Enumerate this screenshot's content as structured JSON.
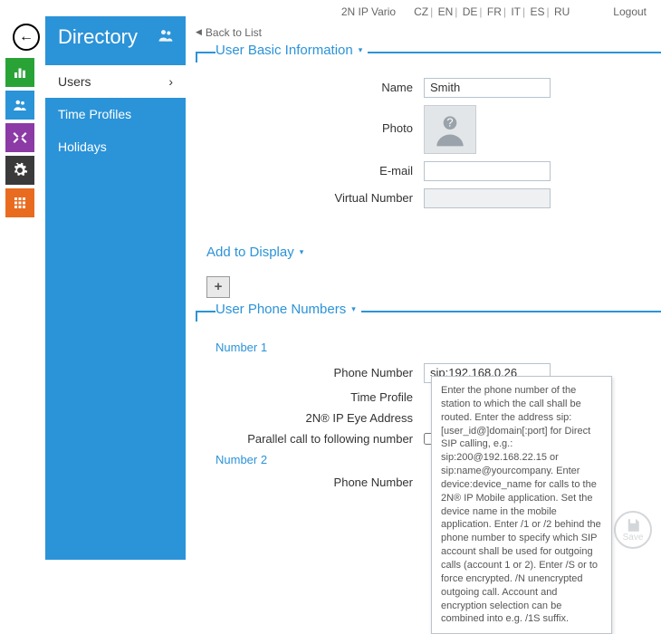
{
  "topbar": {
    "product": "2N IP Vario",
    "langs": [
      "CZ",
      "EN",
      "DE",
      "FR",
      "IT",
      "ES",
      "RU"
    ],
    "logout": "Logout"
  },
  "back_button_glyph": "←",
  "icon_tiles": [
    {
      "name": "status-icon",
      "color": "#2aa336"
    },
    {
      "name": "directory-icon",
      "color": "#2b93d8"
    },
    {
      "name": "tools-icon",
      "color": "#8b3aa6"
    },
    {
      "name": "settings-icon",
      "color": "#3a3a3a"
    },
    {
      "name": "keypad-icon",
      "color": "#e96b1f"
    }
  ],
  "sidebar": {
    "title": "Directory",
    "head_icon": "users-icon",
    "items": [
      {
        "label": "Users",
        "active": true
      },
      {
        "label": "Time Profiles",
        "active": false
      },
      {
        "label": "Holidays",
        "active": false
      }
    ]
  },
  "backlist": "Back to List",
  "sections": {
    "basic": {
      "title": "User Basic Information",
      "fields": {
        "name_label": "Name",
        "name_value": "Smith",
        "photo_label": "Photo",
        "email_label": "E-mail",
        "email_value": "",
        "virtual_label": "Virtual Number",
        "virtual_value": ""
      }
    },
    "display": {
      "title": "Add to Display"
    },
    "phones": {
      "title": "User Phone Numbers",
      "group1": "Number 1",
      "group2": "Number 2",
      "fields": {
        "phone_label": "Phone Number",
        "phone_value": "sip:192.168.0.26",
        "profile_label": "Time Profile",
        "ipeye_label": "2N® IP Eye Address",
        "parallel_label": "Parallel call to following number",
        "phone2_value": ""
      }
    }
  },
  "tooltip": "Enter the phone number of the station to which the call shall be routed. Enter the address sip:[user_id@]domain[:port] for Direct SIP calling, e.g.: sip:200@192.168.22.15 or sip:name@yourcompany. Enter device:device_name for calls to the 2N® IP Mobile application. Set the device name in the mobile application. Enter /1 or /2 behind the phone number to specify which SIP account shall be used for outgoing calls (account 1 or 2). Enter /S or to force encrypted. /N unencrypted outgoing call. Account and encryption selection can be combined into e.g. /1S suffix.",
  "save_label": "Save"
}
